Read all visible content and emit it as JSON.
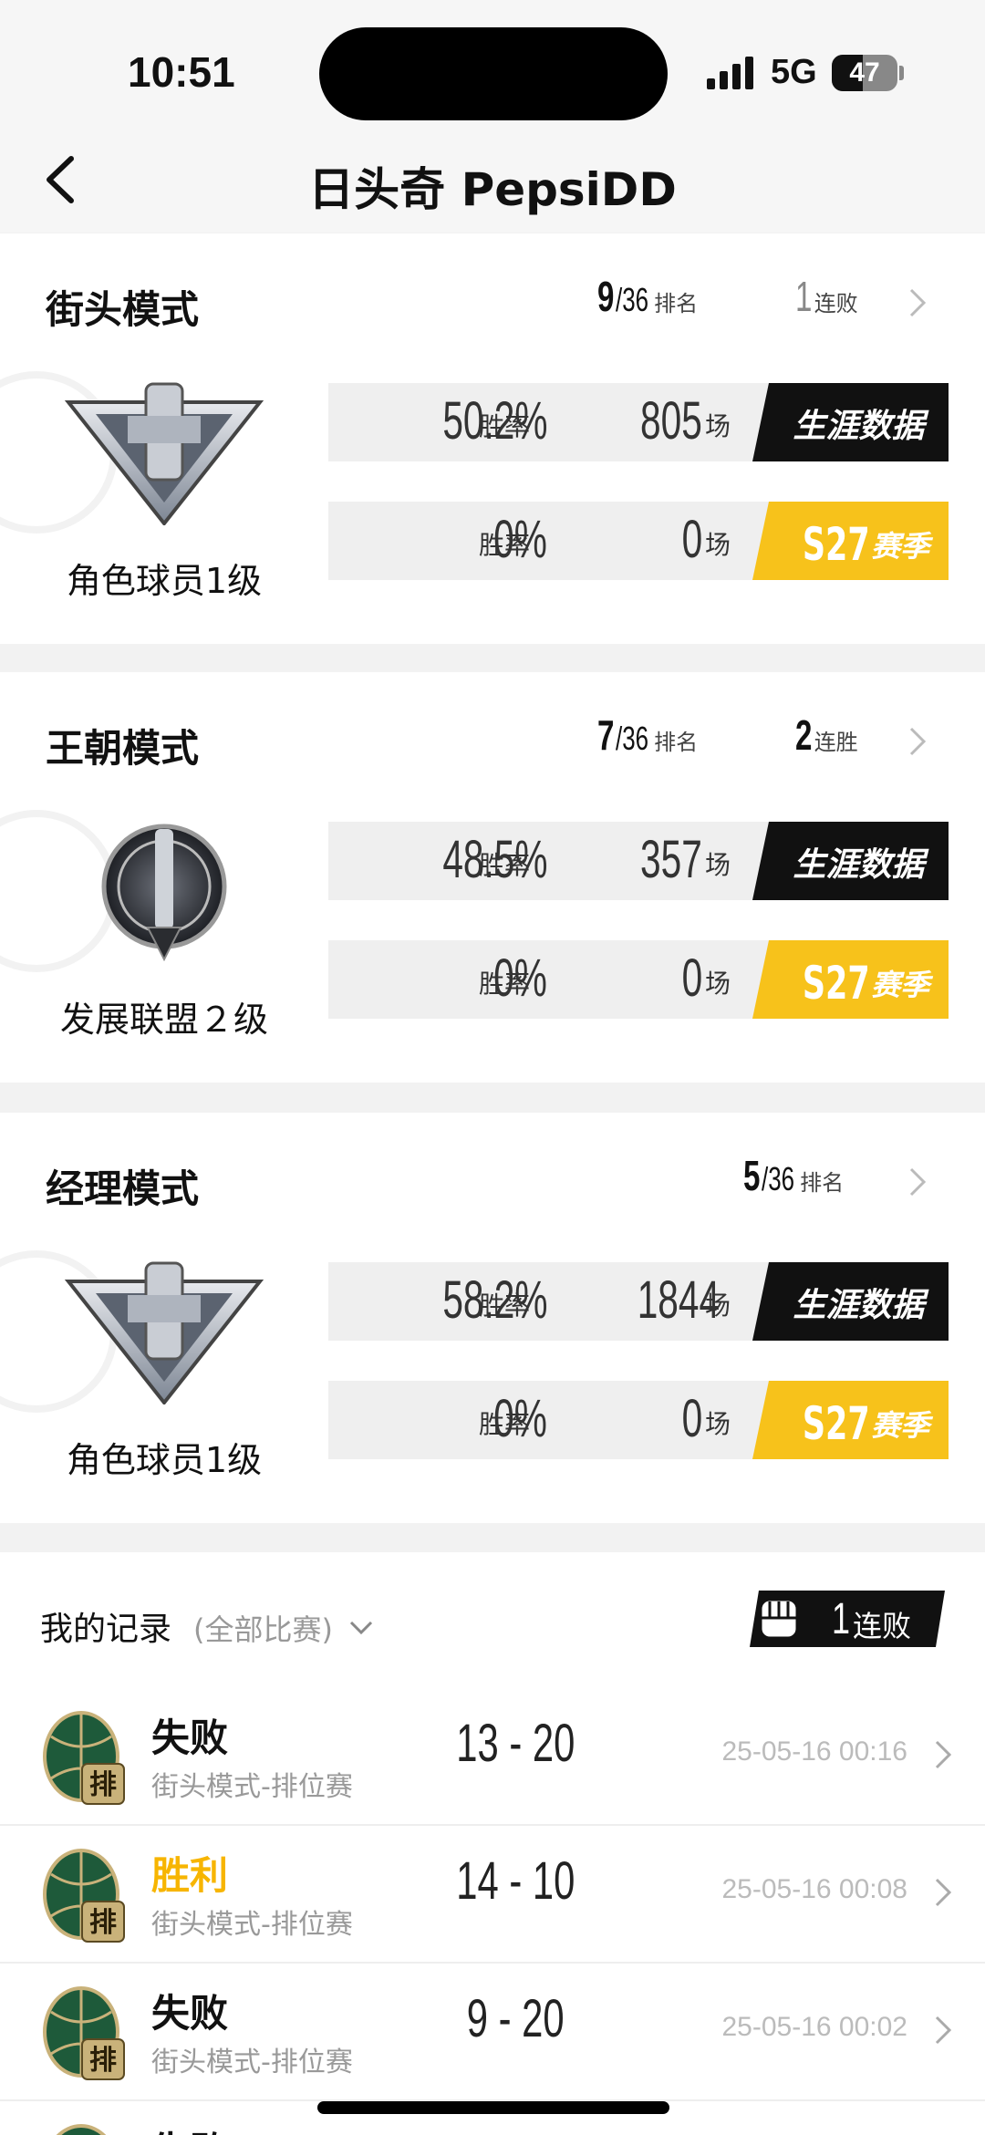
{
  "status_bar": {
    "time": "10:51",
    "network": "5G",
    "battery": "47",
    "battery_level": 0.47
  },
  "nav": {
    "title": "日头奇 PepsiDD"
  },
  "colors": {
    "accent_yellow": "#f7c21b",
    "dark": "#111111",
    "win": "#f7b500"
  },
  "modes": [
    {
      "name": "街头模式",
      "rank": "9",
      "rank_total": "/36",
      "rank_label": "排名",
      "streak_num": "1",
      "streak_label": "连败",
      "level": "角色球员1级",
      "career": {
        "pct": "50.2%",
        "pct_label": "胜率",
        "games": "805",
        "games_label": "场",
        "button": "生涯数据"
      },
      "season": {
        "pct": "0%",
        "pct_label": "胜率",
        "games": "0",
        "games_label": "场",
        "button_s": "S27",
        "button": "赛季"
      }
    },
    {
      "name": "王朝模式",
      "rank": "7",
      "rank_total": "/36",
      "rank_label": "排名",
      "streak_num": "2",
      "streak_label": "连胜",
      "level": "发展联盟２级",
      "career": {
        "pct": "48.5%",
        "pct_label": "胜率",
        "games": "357",
        "games_label": "场",
        "button": "生涯数据"
      },
      "season": {
        "pct": "0%",
        "pct_label": "胜率",
        "games": "0",
        "games_label": "场",
        "button_s": "S27",
        "button": "赛季"
      }
    },
    {
      "name": "经理模式",
      "rank": "5",
      "rank_total": "/36",
      "rank_label": "排名",
      "level": "角色球员1级",
      "career": {
        "pct": "58.2%",
        "pct_label": "胜率",
        "games": "1844",
        "games_label": "场",
        "button": "生涯数据"
      },
      "season": {
        "pct": "0%",
        "pct_label": "胜率",
        "games": "0",
        "games_label": "场",
        "button_s": "S27",
        "button": "赛季"
      }
    }
  ],
  "records": {
    "title": "我的记录",
    "filter": "(全部比赛)",
    "streak_num": "1",
    "streak_label": "连败",
    "badge_char": "排",
    "items": [
      {
        "result": "失败",
        "mode": "街头模式-排位赛",
        "score": "13 - 20",
        "time": "25-05-16 00:16"
      },
      {
        "result": "胜利",
        "mode": "街头模式-排位赛",
        "score": "14 - 10",
        "time": "25-05-16 00:08"
      },
      {
        "result": "失败",
        "mode": "街头模式-排位赛",
        "score": "9 - 20",
        "time": "25-05-16 00:02"
      },
      {
        "result": "失败",
        "mode": "",
        "score": "",
        "time": ""
      }
    ]
  }
}
